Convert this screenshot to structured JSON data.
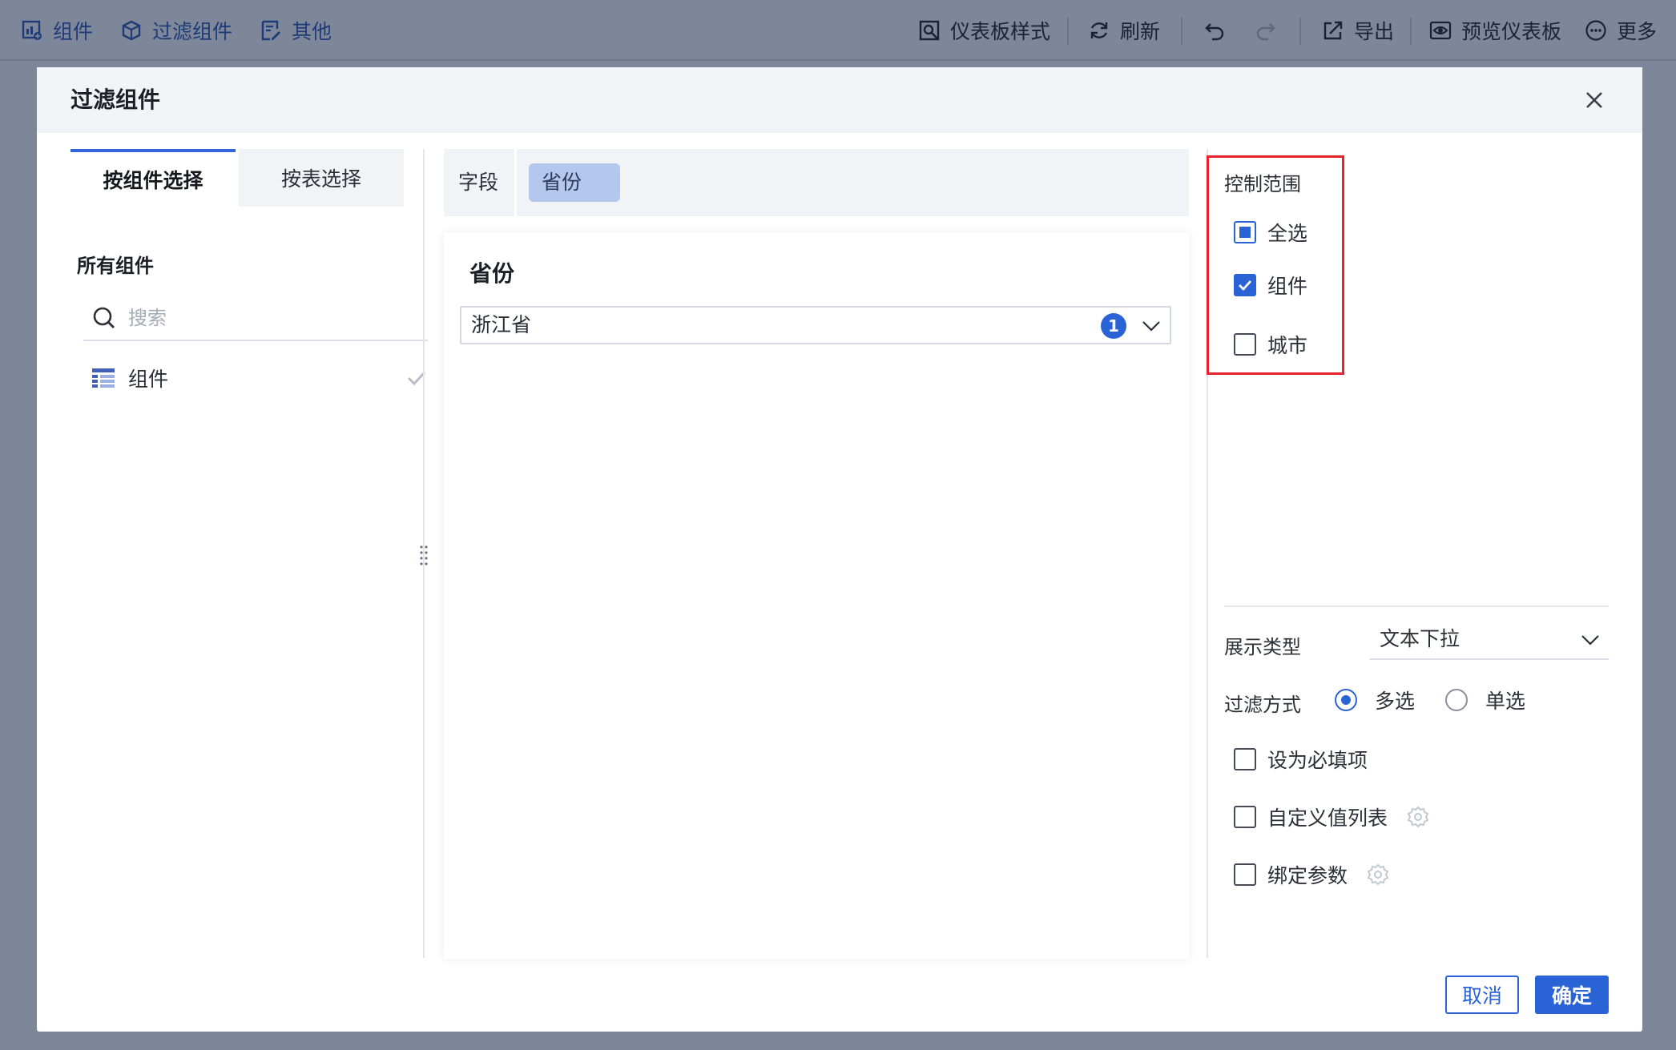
{
  "toolbar": {
    "left_items": [
      {
        "label": "组件",
        "icon": "chart-add-icon"
      },
      {
        "label": "过滤组件",
        "icon": "filter-cube-icon"
      },
      {
        "label": "其他",
        "icon": "other-edit-icon"
      }
    ],
    "right_items": [
      {
        "label": "仪表板样式",
        "icon": "dashboard-style-icon"
      },
      {
        "label": "刷新",
        "icon": "refresh-icon"
      },
      {
        "label": "导出",
        "icon": "export-icon"
      },
      {
        "label": "预览仪表板",
        "icon": "preview-eye-icon"
      },
      {
        "label": "更多",
        "icon": "more-dots-icon"
      }
    ],
    "undo_icon": "undo-icon",
    "redo_icon": "redo-icon"
  },
  "dialog": {
    "title": "过滤组件",
    "close_icon": "close-icon"
  },
  "left_panel": {
    "tabs": [
      {
        "label": "按组件选择",
        "active": true
      },
      {
        "label": "按表选择",
        "active": false
      }
    ],
    "section_label": "所有组件",
    "search_placeholder": "搜索",
    "items": [
      {
        "label": "组件",
        "icon": "table-icon",
        "selected": true
      }
    ]
  },
  "middle_panel": {
    "field_label": "字段",
    "field_chip": "省份",
    "preview_title": "省份",
    "select_value": "浙江省",
    "select_count": "1"
  },
  "right_panel": {
    "scope_title": "控制范围",
    "scope_options": [
      {
        "label": "全选",
        "state": "indeterminate"
      },
      {
        "label": "组件",
        "state": "checked"
      },
      {
        "label": "城市",
        "state": "unchecked"
      }
    ],
    "display_type_label": "展示类型",
    "display_type_value": "文本下拉",
    "filter_mode_label": "过滤方式",
    "filter_modes": [
      {
        "label": "多选",
        "selected": true
      },
      {
        "label": "单选",
        "selected": false
      }
    ],
    "options": [
      {
        "label": "设为必填项",
        "checked": false,
        "has_gear": false
      },
      {
        "label": "自定义值列表",
        "checked": false,
        "has_gear": true
      },
      {
        "label": "绑定参数",
        "checked": false,
        "has_gear": true
      }
    ]
  },
  "footer": {
    "cancel_label": "取消",
    "ok_label": "确定"
  },
  "colors": {
    "accent": "#2a63d6",
    "highlight_border": "#e8222c",
    "overlay_bg": "#7d8799"
  }
}
